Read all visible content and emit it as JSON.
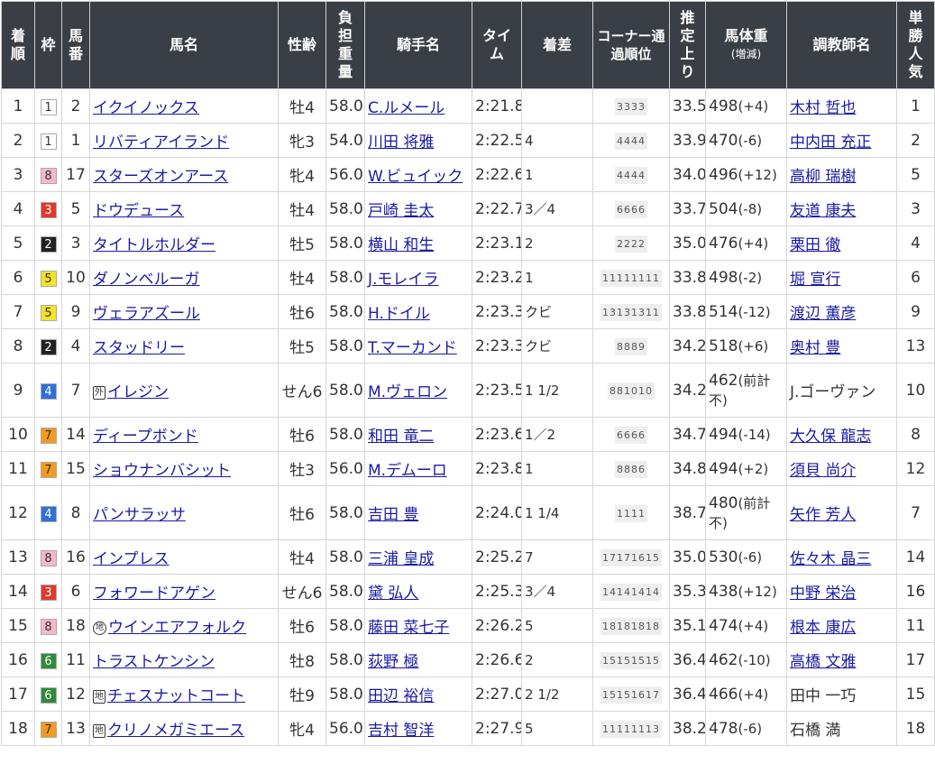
{
  "headers": {
    "rank": "着順",
    "waku": "枠",
    "num": "馬番",
    "name": "馬名",
    "sexage": "性齢",
    "weight": "負担重量",
    "jockey": "騎手名",
    "time": "タイム",
    "margin": "着差",
    "corner": "コーナー通過順位",
    "last3f": "推定上り",
    "body_weight": "馬体重",
    "body_weight_sub": "(増減)",
    "trainer": "調教師名",
    "pop": "単勝人気"
  },
  "rows": [
    {
      "rank": "1",
      "waku": "1",
      "num": "2",
      "mark": "",
      "name": "イクイノックス",
      "sexage": "牡4",
      "weight": "58.0",
      "jockey": "C.ルメール",
      "jockey_link": true,
      "time": "2:21.8",
      "margin": "",
      "corner": "3333",
      "last3f": "33.5",
      "bw": "498",
      "bwd": "(+4)",
      "trainer": "木村 哲也",
      "trainer_link": true,
      "pop": "1"
    },
    {
      "rank": "2",
      "waku": "1",
      "num": "1",
      "mark": "",
      "name": "リバティアイランド",
      "sexage": "牝3",
      "weight": "54.0",
      "jockey": "川田 将雅",
      "jockey_link": true,
      "time": "2:22.5",
      "margin": "4",
      "corner": "4444",
      "last3f": "33.9",
      "bw": "470",
      "bwd": "(-6)",
      "trainer": "中内田 充正",
      "trainer_link": true,
      "pop": "2"
    },
    {
      "rank": "3",
      "waku": "8",
      "num": "17",
      "mark": "",
      "name": "スターズオンアース",
      "sexage": "牝4",
      "weight": "56.0",
      "jockey": "W.ビュイック",
      "jockey_link": true,
      "time": "2:22.6",
      "margin": "1",
      "corner": "4444",
      "last3f": "34.0",
      "bw": "496",
      "bwd": "(+12)",
      "trainer": "高柳 瑞樹",
      "trainer_link": true,
      "pop": "5"
    },
    {
      "rank": "4",
      "waku": "3",
      "num": "5",
      "mark": "",
      "name": "ドウデュース",
      "sexage": "牡4",
      "weight": "58.0",
      "jockey": "戸崎 圭太",
      "jockey_link": true,
      "time": "2:22.7",
      "margin": "3／4",
      "corner": "6666",
      "last3f": "33.7",
      "bw": "504",
      "bwd": "(-8)",
      "trainer": "友道 康夫",
      "trainer_link": true,
      "pop": "3"
    },
    {
      "rank": "5",
      "waku": "2",
      "num": "3",
      "mark": "",
      "name": "タイトルホルダー",
      "sexage": "牡5",
      "weight": "58.0",
      "jockey": "横山 和生",
      "jockey_link": true,
      "time": "2:23.1",
      "margin": "2",
      "corner": "2222",
      "last3f": "35.0",
      "bw": "476",
      "bwd": "(+4)",
      "trainer": "栗田 徹",
      "trainer_link": true,
      "pop": "4"
    },
    {
      "rank": "6",
      "waku": "5",
      "num": "10",
      "mark": "",
      "name": "ダノンベルーガ",
      "sexage": "牡4",
      "weight": "58.0",
      "jockey": "J.モレイラ",
      "jockey_link": true,
      "time": "2:23.2",
      "margin": "1",
      "corner": "11111111",
      "last3f": "33.8",
      "bw": "498",
      "bwd": "(-2)",
      "trainer": "堀 宣行",
      "trainer_link": true,
      "pop": "6"
    },
    {
      "rank": "7",
      "waku": "5",
      "num": "9",
      "mark": "",
      "name": "ヴェラアズール",
      "sexage": "牡6",
      "weight": "58.0",
      "jockey": "H.ドイル",
      "jockey_link": true,
      "time": "2:23.3",
      "margin": "クビ",
      "corner": "13131311",
      "last3f": "33.8",
      "bw": "514",
      "bwd": "(-12)",
      "trainer": "渡辺 薫彦",
      "trainer_link": true,
      "pop": "9"
    },
    {
      "rank": "8",
      "waku": "2",
      "num": "4",
      "mark": "",
      "name": "スタッドリー",
      "sexage": "牡5",
      "weight": "58.0",
      "jockey": "T.マーカンド",
      "jockey_link": true,
      "time": "2:23.3",
      "margin": "クビ",
      "corner": "8889",
      "last3f": "34.2",
      "bw": "518",
      "bwd": "(+6)",
      "trainer": "奥村 豊",
      "trainer_link": true,
      "pop": "13"
    },
    {
      "rank": "9",
      "waku": "4",
      "num": "7",
      "mark": "外",
      "name": "イレジン",
      "sexage": "せん6",
      "weight": "58.0",
      "jockey": "M.ヴェロン",
      "jockey_link": true,
      "time": "2:23.5",
      "margin": "1 1/2",
      "corner": "881010",
      "last3f": "34.2",
      "bw": "462",
      "bwd": "(前計不)",
      "trainer": "J.ゴーヴァン",
      "trainer_link": false,
      "pop": "10",
      "tall": true
    },
    {
      "rank": "10",
      "waku": "7",
      "num": "14",
      "mark": "",
      "name": "ディープボンド",
      "sexage": "牡6",
      "weight": "58.0",
      "jockey": "和田 竜二",
      "jockey_link": true,
      "time": "2:23.6",
      "margin": "1／2",
      "corner": "6666",
      "last3f": "34.7",
      "bw": "494",
      "bwd": "(-14)",
      "trainer": "大久保 龍志",
      "trainer_link": true,
      "pop": "8"
    },
    {
      "rank": "11",
      "waku": "7",
      "num": "15",
      "mark": "",
      "name": "ショウナンバシット",
      "sexage": "牡3",
      "weight": "56.0",
      "jockey": "M.デムーロ",
      "jockey_link": true,
      "time": "2:23.8",
      "margin": "1",
      "corner": "8886",
      "last3f": "34.8",
      "bw": "494",
      "bwd": "(+2)",
      "trainer": "須貝 尚介",
      "trainer_link": true,
      "pop": "12"
    },
    {
      "rank": "12",
      "waku": "4",
      "num": "8",
      "mark": "",
      "name": "パンサラッサ",
      "sexage": "牡6",
      "weight": "58.0",
      "jockey": "吉田 豊",
      "jockey_link": true,
      "time": "2:24.0",
      "margin": "1 1/4",
      "corner": "1111",
      "last3f": "38.7",
      "bw": "480",
      "bwd": "(前計不)",
      "trainer": "矢作 芳人",
      "trainer_link": true,
      "pop": "7",
      "tall": true
    },
    {
      "rank": "13",
      "waku": "8",
      "num": "16",
      "mark": "",
      "name": "インプレス",
      "sexage": "牡4",
      "weight": "58.0",
      "jockey": "三浦 皇成",
      "jockey_link": true,
      "time": "2:25.2",
      "margin": "7",
      "corner": "17171615",
      "last3f": "35.0",
      "bw": "530",
      "bwd": "(-6)",
      "trainer": "佐々木 晶三",
      "trainer_link": true,
      "pop": "14"
    },
    {
      "rank": "14",
      "waku": "3",
      "num": "6",
      "mark": "",
      "name": "フォワードアゲン",
      "sexage": "せん6",
      "weight": "58.0",
      "jockey": "黛 弘人",
      "jockey_link": true,
      "time": "2:25.3",
      "margin": "3／4",
      "corner": "14141414",
      "last3f": "35.3",
      "bw": "438",
      "bwd": "(+12)",
      "trainer": "中野 栄治",
      "trainer_link": true,
      "pop": "16"
    },
    {
      "rank": "15",
      "waku": "8",
      "num": "18",
      "mark": "地c",
      "name": "ウインエアフォルク",
      "sexage": "牡6",
      "weight": "58.0",
      "jockey": "藤田 菜七子",
      "jockey_link": true,
      "time": "2:26.2",
      "margin": "5",
      "corner": "18181818",
      "last3f": "35.1",
      "bw": "474",
      "bwd": "(+4)",
      "trainer": "根本 康広",
      "trainer_link": true,
      "pop": "11"
    },
    {
      "rank": "16",
      "waku": "6",
      "num": "11",
      "mark": "",
      "name": "トラストケンシン",
      "sexage": "牡8",
      "weight": "58.0",
      "jockey": "荻野 極",
      "jockey_link": true,
      "time": "2:26.6",
      "margin": "2",
      "corner": "15151515",
      "last3f": "36.4",
      "bw": "462",
      "bwd": "(-10)",
      "trainer": "高橋 文雅",
      "trainer_link": true,
      "pop": "17"
    },
    {
      "rank": "17",
      "waku": "6",
      "num": "12",
      "mark": "地",
      "name": "チェスナットコート",
      "sexage": "牡9",
      "weight": "58.0",
      "jockey": "田辺 裕信",
      "jockey_link": true,
      "time": "2:27.0",
      "margin": "2 1/2",
      "corner": "15151617",
      "last3f": "36.4",
      "bw": "466",
      "bwd": "(+4)",
      "trainer": "田中 一巧",
      "trainer_link": false,
      "pop": "15"
    },
    {
      "rank": "18",
      "waku": "7",
      "num": "13",
      "mark": "地",
      "name": "クリノメガミエース",
      "sexage": "牝4",
      "weight": "56.0",
      "jockey": "吉村 智洋",
      "jockey_link": true,
      "time": "2:27.9",
      "margin": "5",
      "corner": "11111113",
      "last3f": "38.2",
      "bw": "478",
      "bwd": "(-6)",
      "trainer": "石橋 満",
      "trainer_link": false,
      "pop": "18"
    }
  ],
  "waku_colors": {
    "1": {
      "bg": "#ffffff",
      "fg": "#333333"
    },
    "2": {
      "bg": "#222222",
      "fg": "#ffffff"
    },
    "3": {
      "bg": "#e0392b",
      "fg": "#ffffff"
    },
    "4": {
      "bg": "#2f6fd6",
      "fg": "#ffffff"
    },
    "5": {
      "bg": "#f5e12a",
      "fg": "#333333"
    },
    "6": {
      "bg": "#2e8b3a",
      "fg": "#ffffff"
    },
    "7": {
      "bg": "#f39a1f",
      "fg": "#333333"
    },
    "8": {
      "bg": "#f7b7c8",
      "fg": "#333333"
    }
  }
}
